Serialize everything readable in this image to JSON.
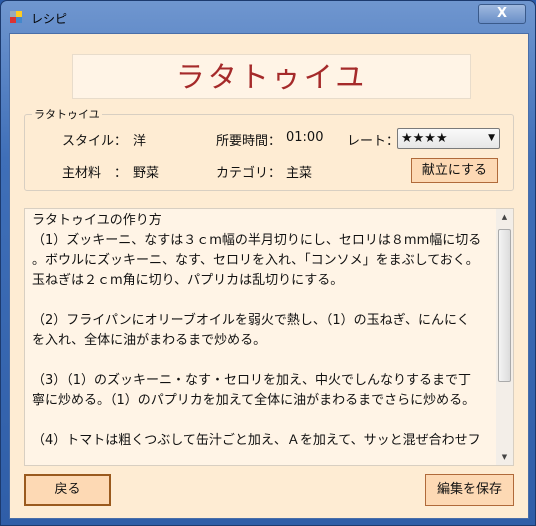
{
  "window": {
    "title": "レシピ",
    "close_label": "X"
  },
  "recipe": {
    "title": "ラタトゥイユ",
    "group_label": "ラタトゥイユ",
    "style_label": "スタイル：",
    "style_value": "洋",
    "time_label": "所要時間：",
    "time_value": "01:00",
    "rate_label": "レート：",
    "rate_value": "★★★★",
    "ingredient_label": "主材料　：",
    "ingredient_value": "野菜",
    "category_label": "カテゴリ：",
    "category_value": "主菜",
    "menu_button": "献立にする"
  },
  "instructions": {
    "lines": [
      "ラタトゥイユの作り方",
      "（1）ズッキーニ、なすは３ｃm幅の半月切りにし、セロリは８mm幅に切る",
      "。ボウルにズッキーニ、なす、セロリを入れ、「コンソメ」をまぶしておく。",
      "玉ねぎは２ｃm角に切り、パプリカは乱切りにする。",
      "",
      "（2）フライパンにオリーブオイルを弱火で熱し、（1）の玉ねぎ、にんにく",
      "を入れ、全体に油がまわるまで炒める。",
      "",
      "（3）（1）のズッキーニ・なす・セロリを加え、中火でしんなりするまで丁",
      "寧に炒める。（1）のパプリカを加えて全体に油がまわるまでさらに炒める。",
      "",
      "（4）トマトは粗くつぶして缶汁ごと加え、Ａを加えて、サッと混ぜ合わせフ"
    ]
  },
  "buttons": {
    "back": "戻る",
    "save": "編集を保存"
  }
}
